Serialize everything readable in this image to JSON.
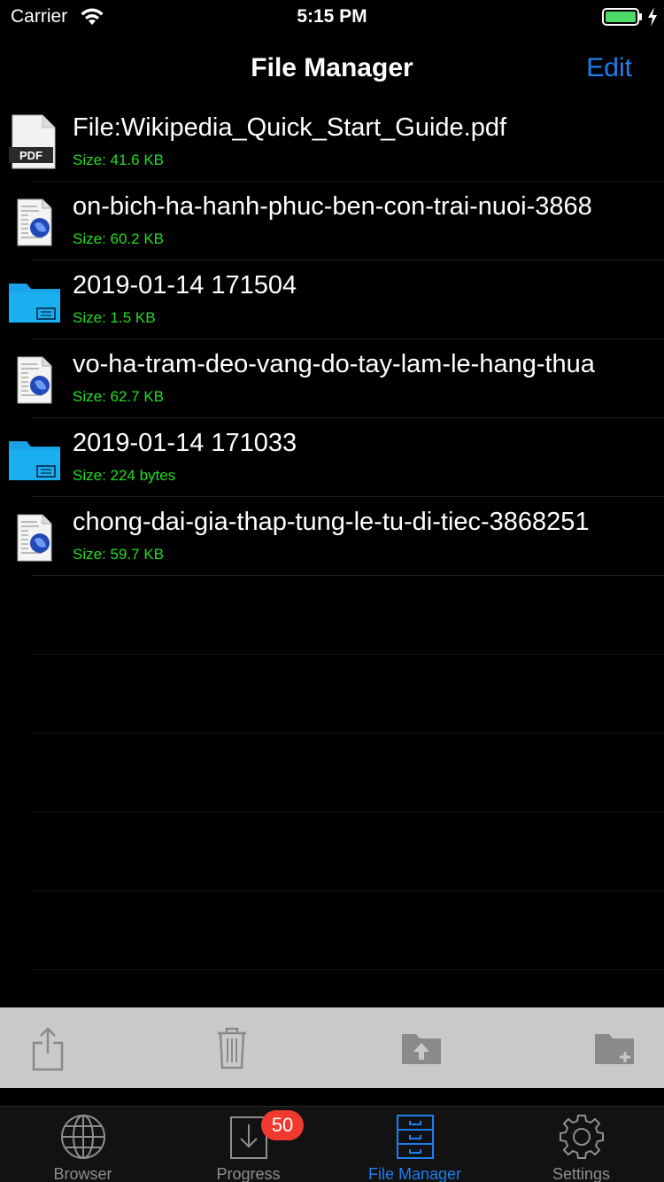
{
  "status_bar": {
    "carrier": "Carrier",
    "time": "5:15 PM"
  },
  "nav": {
    "title": "File Manager",
    "edit_label": "Edit"
  },
  "files": [
    {
      "name": "File:Wikipedia_Quick_Start_Guide.pdf",
      "size": "Size: 41.6 KB",
      "icon": "pdf-file-icon"
    },
    {
      "name": "on-bich-ha-hanh-phuc-ben-con-trai-nuoi-3868",
      "size": "Size: 60.2 KB",
      "icon": "web-document-icon"
    },
    {
      "name": "2019-01-14 171504",
      "size": "Size: 1.5 KB",
      "icon": "folder-icon"
    },
    {
      "name": "vo-ha-tram-deo-vang-do-tay-lam-le-hang-thua",
      "size": "Size: 62.7 KB",
      "icon": "web-document-icon"
    },
    {
      "name": "2019-01-14 171033",
      "size": "Size: 224 bytes",
      "icon": "folder-icon"
    },
    {
      "name": "chong-dai-gia-thap-tung-le-tu-di-tiec-3868251",
      "size": "Size: 59.7 KB",
      "icon": "web-document-icon"
    }
  ],
  "pdf_badge_text": "PDF",
  "toolbar": {
    "share_icon": "share-icon",
    "trash_icon": "trash-icon",
    "move_up_icon": "folder-upload-icon",
    "new_folder_icon": "folder-add-icon"
  },
  "tabs": [
    {
      "label": "Browser",
      "icon": "globe-icon",
      "active": false
    },
    {
      "label": "Progress",
      "icon": "download-icon",
      "active": false,
      "badge": "50"
    },
    {
      "label": "File Manager",
      "icon": "file-cabinet-icon",
      "active": true
    },
    {
      "label": "Settings",
      "icon": "gear-icon",
      "active": false
    }
  ],
  "colors": {
    "accent": "#1e7ef0",
    "size_text": "#22dd22",
    "badge": "#f03a2f",
    "folder": "#1aa3e8"
  }
}
